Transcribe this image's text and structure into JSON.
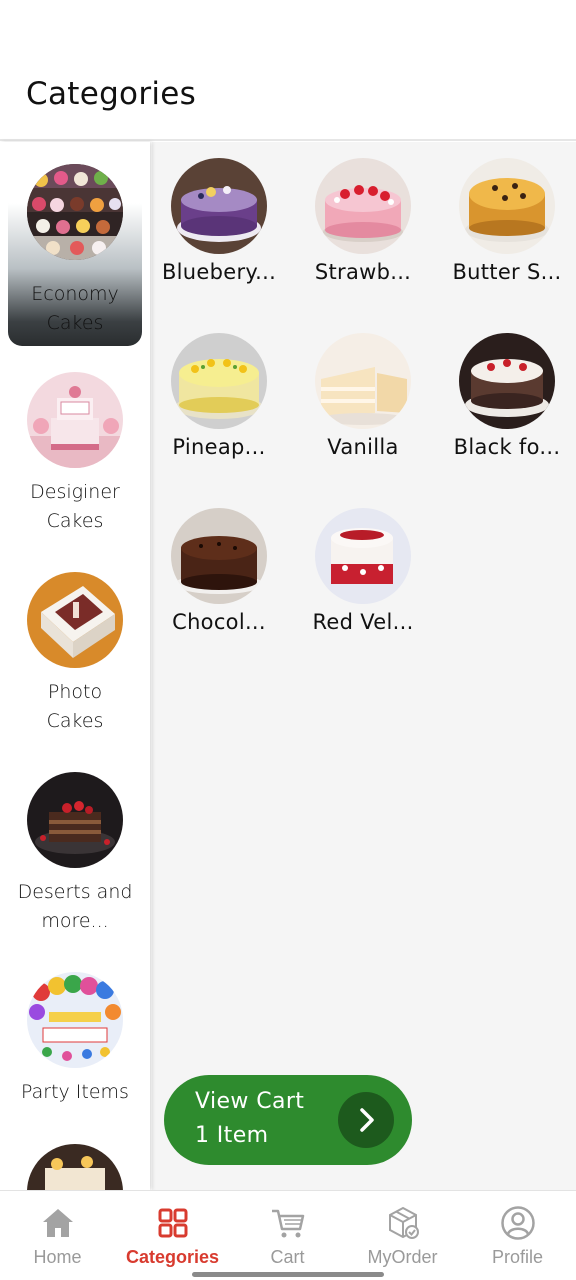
{
  "header": {
    "title": "Categories"
  },
  "sidebar": {
    "items": [
      {
        "label": "Economy Cakes"
      },
      {
        "label": "Desiginer Cakes"
      },
      {
        "label": "Photo Cakes"
      },
      {
        "label": "Deserts and more..."
      },
      {
        "label": "Party Items"
      }
    ]
  },
  "products": [
    {
      "label": "Bluebery...",
      "icon": "blueberry-cake-image"
    },
    {
      "label": "Strawb...",
      "icon": "strawberry-cake-image"
    },
    {
      "label": "Butter S...",
      "icon": "butterscotch-cake-image"
    },
    {
      "label": "Pineap...",
      "icon": "pineapple-cake-image"
    },
    {
      "label": "Vanilla",
      "icon": "vanilla-cake-image"
    },
    {
      "label": "Black fo...",
      "icon": "black-forest-cake-image"
    },
    {
      "label": "Chocol...",
      "icon": "chocolate-cake-image"
    },
    {
      "label": "Red Vel...",
      "icon": "red-velvet-cake-image"
    }
  ],
  "cart_button": {
    "title": "View Cart",
    "count": "1 Item"
  },
  "nav": {
    "items": [
      {
        "label": "Home",
        "icon": "home-icon"
      },
      {
        "label": "Categories",
        "icon": "grid-icon"
      },
      {
        "label": "Cart",
        "icon": "cart-icon"
      },
      {
        "label": "MyOrder",
        "icon": "package-icon"
      },
      {
        "label": "Profile",
        "icon": "profile-icon"
      }
    ]
  },
  "colors": {
    "accent": "#d83b2f",
    "cart_green": "#2e8b2e",
    "cart_green_dark": "#1d5a1d"
  }
}
